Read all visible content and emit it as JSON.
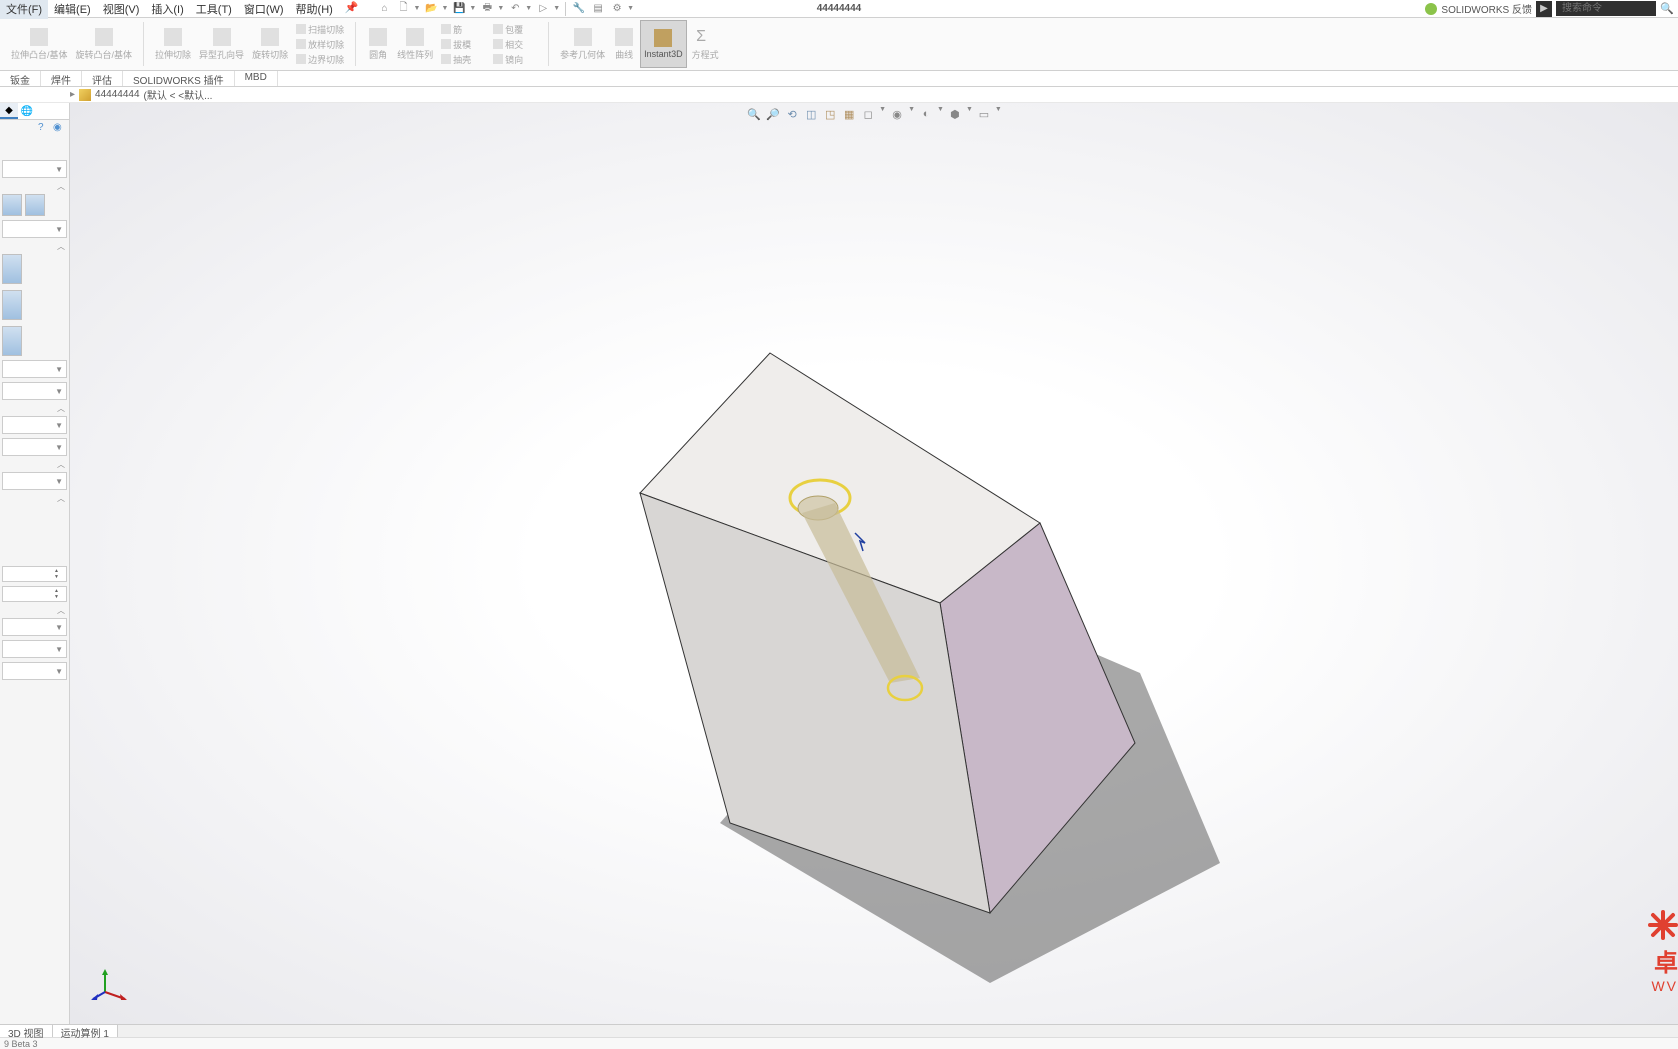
{
  "menu": {
    "file": "文件(F)",
    "edit": "编辑(E)",
    "view": "视图(V)",
    "insert": "插入(I)",
    "tools": "工具(T)",
    "window": "窗口(W)",
    "help": "帮助(H)"
  },
  "title": "44444444",
  "brand": "SOLIDWORKS 反馈",
  "search_placeholder": "搜索命令",
  "ribbon": {
    "extrude": "拉伸凸台/基体",
    "revolve": "旋转凸台/基体",
    "swept": "扫描切除",
    "loft_cut": "放样切除",
    "boundary_cut": "边界切除",
    "extrude_cut": "拉伸切除",
    "hole": "异型孔向导",
    "revolve_cut": "旋转切除",
    "fillet": "圆角",
    "pattern": "线性阵列",
    "rib": "筋",
    "draft": "拔模",
    "shell": "抽壳",
    "wrap": "包覆",
    "intersect": "相交",
    "mirror": "镜向",
    "refgeo": "参考几何体",
    "curves": "曲线",
    "instant3d": "Instant3D",
    "equation": "方程式"
  },
  "tabs": {
    "sheet_metal": "钣金",
    "weldment": "焊件",
    "evaluate": "评估",
    "plugins": "SOLIDWORKS 插件",
    "mbd": "MBD"
  },
  "breadcrumb": {
    "name": "44444444",
    "config": "(默认 < <默认..."
  },
  "bottom": {
    "view3d": "3D 视图",
    "motion": "运动算例 1"
  },
  "status": "9 Beta 3",
  "watermark": {
    "text": "卓",
    "sub": "WV"
  }
}
